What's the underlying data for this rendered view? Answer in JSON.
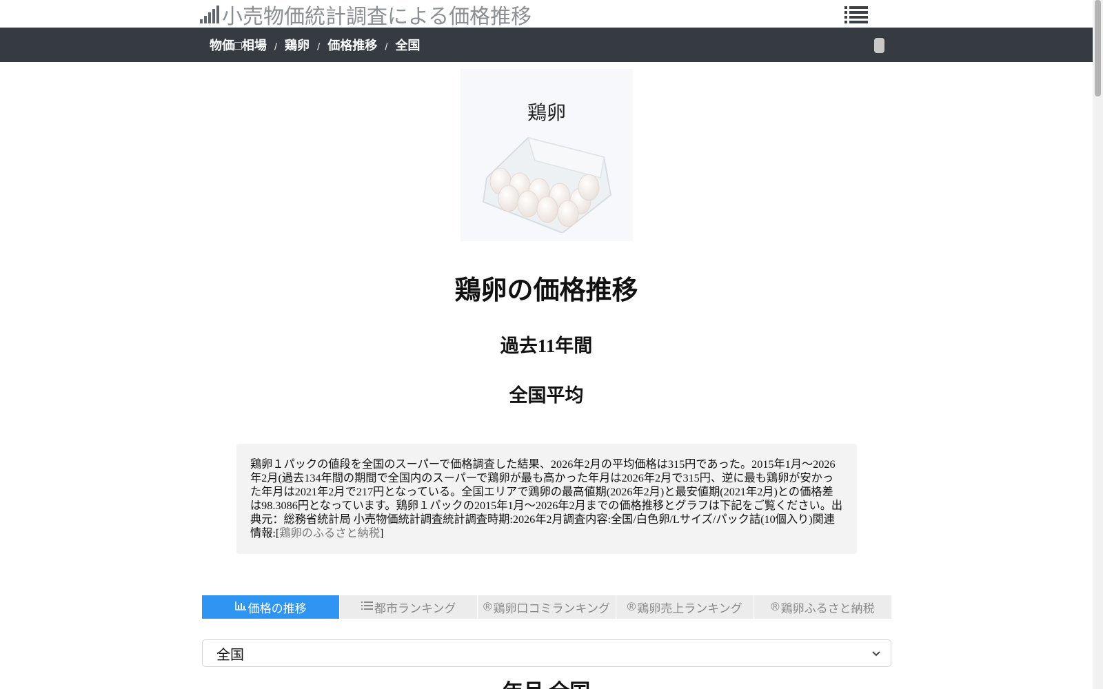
{
  "header": {
    "site_title": "小売物価統計調査による価格推移",
    "icons": {
      "logo": "signal-bars-icon",
      "menu": "list-menu-icon"
    }
  },
  "breadcrumb": {
    "items": [
      {
        "label": "物価□相場"
      },
      {
        "label": "鶏卵"
      },
      {
        "label": "価格推移"
      },
      {
        "label": "全国"
      }
    ],
    "separator": "/"
  },
  "product": {
    "name": "鶏卵"
  },
  "headings": {
    "title": "鶏卵の価格推移",
    "period": "過去11年間",
    "region": "全国平均"
  },
  "description": {
    "text": "鶏卵１パックの値段を全国のスーパーで価格調査した結果、2026年2月の平均価格は315円であった。2015年1月〜2026年2月(過去134年間の期間で全国内のスーパーで鶏卵が最も高かった年月は2026年2月で315円、逆に最も鶏卵が安かった年月は2021年2月で217円となっている。全国エリアで鶏卵の最高値期(2026年2月)と最安値期(2021年2月)との価格差は98.3086円となっています。鶏卵１パックの2015年1月〜2026年2月までの価格推移とグラフは下記をご覧ください。出典元：総務省統計局 小売物価統計調査統計調査時期:2026年2月調査内容:全国/白色卵/Lサイズ/パック詰(10個入り)関連情報:[",
    "link_label": "鶏卵のふるさと納税",
    "closing": "]"
  },
  "tabs": [
    {
      "label": "価格の推移",
      "icon": "bar-chart-icon",
      "icon_glyph": "📊",
      "active": true
    },
    {
      "label": "都市ランキング",
      "icon": "list-icon",
      "icon_glyph": "☷",
      "active": false
    },
    {
      "label": "鶏卵口コミランキング",
      "icon": "registered-icon",
      "icon_glyph": "®",
      "active": false
    },
    {
      "label": "鶏卵売上ランキング",
      "icon": "registered-icon",
      "icon_glyph": "®",
      "active": false
    },
    {
      "label": "鶏卵ふるさと納税",
      "icon": "registered-icon",
      "icon_glyph": "®",
      "active": false
    }
  ],
  "region_select": {
    "selected": "全国"
  },
  "next_heading": "年月 全国",
  "colors": {
    "nav_bg": "#353b41",
    "active_tab": "#2e95f2",
    "desc_bg": "#f3f3f3"
  }
}
